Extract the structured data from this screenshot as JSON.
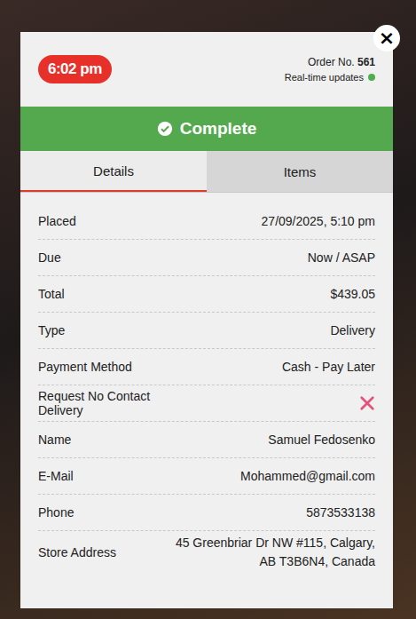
{
  "close": "×",
  "header": {
    "time": "6:02 pm",
    "order_label": "Order No.",
    "order_number": "561",
    "live": "Real-time updates",
    "live_on": true
  },
  "status": {
    "label": "Complete"
  },
  "tabs": [
    {
      "label": "Details",
      "selected": true
    },
    {
      "label": "Items",
      "selected": false
    }
  ],
  "details": [
    {
      "label": "Placed",
      "kind": "text",
      "value": "27/09/2025, 5:10 pm"
    },
    {
      "label": "Due",
      "kind": "text",
      "value": "Now / ASAP"
    },
    {
      "label": "Total",
      "kind": "text",
      "value": "$439.05"
    },
    {
      "label": "Type",
      "kind": "text",
      "value": "Delivery"
    },
    {
      "label": "Payment Method",
      "kind": "text",
      "value": "Cash - Pay Later"
    },
    {
      "label": "Request No Contact Delivery",
      "kind": "flag",
      "checked": false
    },
    {
      "label": "Name",
      "kind": "text",
      "value": "Samuel Fedosenko"
    },
    {
      "label": "E-Mail",
      "kind": "text",
      "value": "Mohammed@gmail.com"
    },
    {
      "label": "Phone",
      "kind": "text",
      "value": "5873533138"
    },
    {
      "label": "Store Address",
      "kind": "text",
      "value": "45 Greenbriar Dr NW #115, Calgary, AB T3B6N4, Canada"
    }
  ]
}
